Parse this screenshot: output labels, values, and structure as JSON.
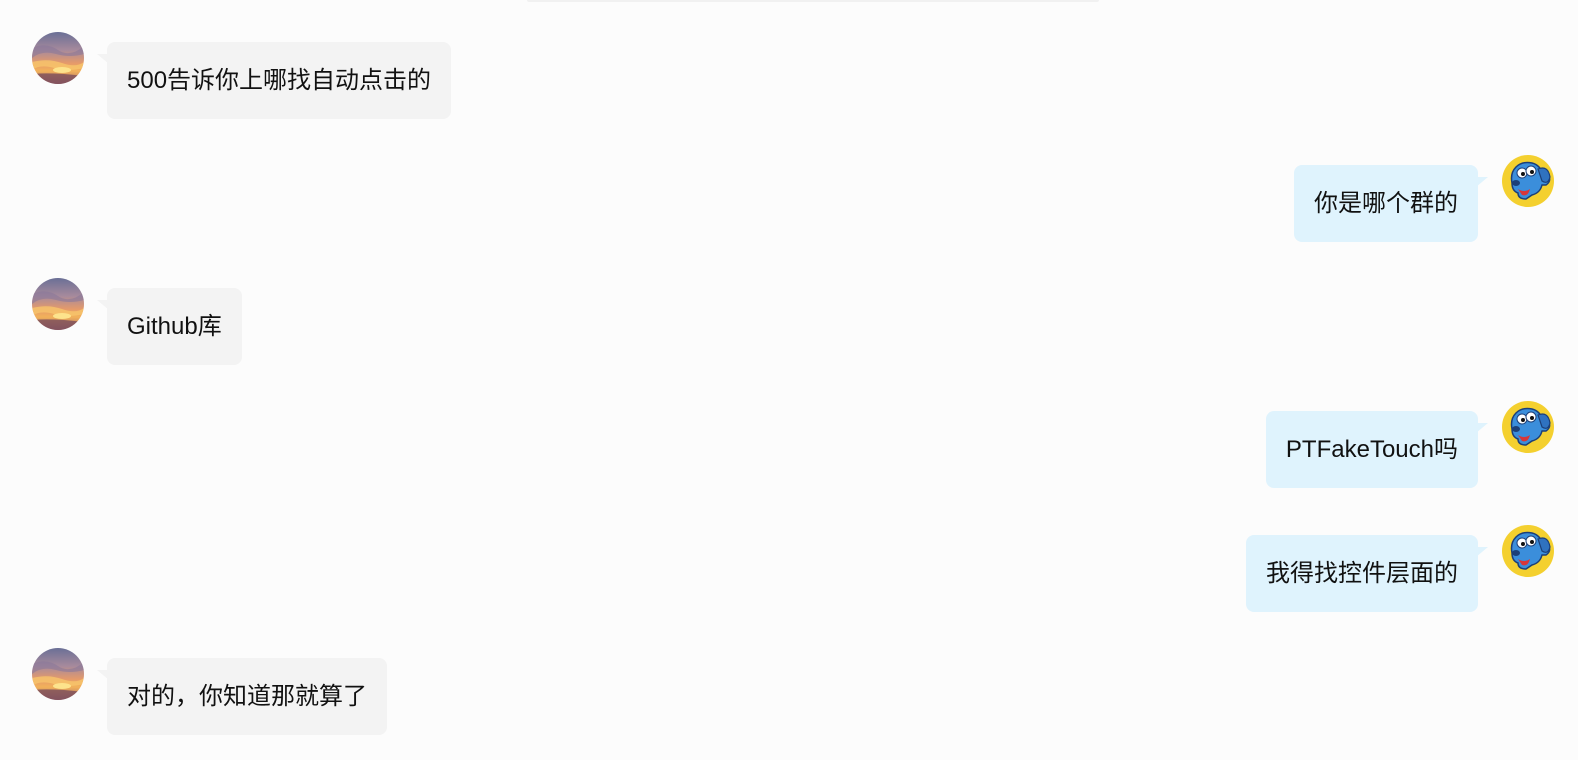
{
  "messages": [
    {
      "side": "left",
      "avatar": "sunset-avatar-icon",
      "text": "500告诉你上哪找自动点击的"
    },
    {
      "side": "right",
      "avatar": "blue-dog-avatar-icon",
      "text": "你是哪个群的"
    },
    {
      "side": "left",
      "avatar": "sunset-avatar-icon",
      "text": "Github库"
    },
    {
      "side": "right",
      "avatar": "blue-dog-avatar-icon",
      "text": "PTFakeTouch吗"
    },
    {
      "side": "right",
      "avatar": "blue-dog-avatar-icon",
      "text": "我得找控件层面的"
    },
    {
      "side": "left",
      "avatar": "sunset-avatar-icon",
      "text": "对的，你知道那就算了"
    }
  ],
  "colors": {
    "page_background": "#fcfcfc",
    "incoming_bubble": "#f3f3f3",
    "outgoing_bubble": "#dff3fd",
    "text": "#111111",
    "dog_avatar_ring": "#f4d02f",
    "dog_avatar_body": "#3b8edb"
  }
}
